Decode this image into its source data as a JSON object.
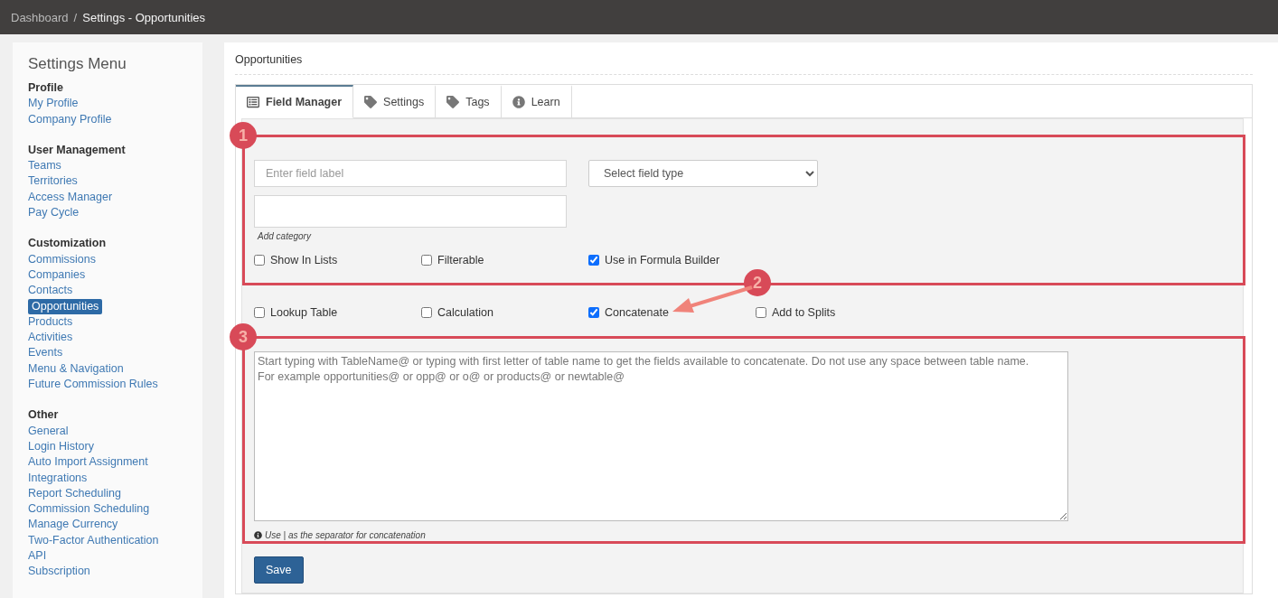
{
  "breadcrumb": {
    "items": [
      {
        "label": "Dashboard",
        "current": false
      },
      {
        "label": "Settings - Opportunities",
        "current": true
      }
    ],
    "separator": "/"
  },
  "sidebar": {
    "title": "Settings Menu",
    "groups": [
      {
        "heading": "Profile",
        "items": [
          {
            "label": "My Profile",
            "selected": false
          },
          {
            "label": "Company Profile",
            "selected": false
          }
        ]
      },
      {
        "heading": "User Management",
        "items": [
          {
            "label": "Teams",
            "selected": false
          },
          {
            "label": "Territories",
            "selected": false
          },
          {
            "label": "Access Manager",
            "selected": false
          },
          {
            "label": "Pay Cycle",
            "selected": false
          }
        ]
      },
      {
        "heading": "Customization",
        "items": [
          {
            "label": "Commissions",
            "selected": false
          },
          {
            "label": "Companies",
            "selected": false
          },
          {
            "label": "Contacts",
            "selected": false
          },
          {
            "label": "Opportunities",
            "selected": true
          },
          {
            "label": "Products",
            "selected": false
          },
          {
            "label": "Activities",
            "selected": false
          },
          {
            "label": "Events",
            "selected": false
          },
          {
            "label": "Menu & Navigation",
            "selected": false
          },
          {
            "label": "Future Commission Rules",
            "selected": false
          }
        ]
      },
      {
        "heading": "Other",
        "items": [
          {
            "label": "General",
            "selected": false
          },
          {
            "label": "Login History",
            "selected": false
          },
          {
            "label": "Auto Import Assignment",
            "selected": false
          },
          {
            "label": "Integrations",
            "selected": false
          },
          {
            "label": "Report Scheduling",
            "selected": false
          },
          {
            "label": "Commission Scheduling",
            "selected": false
          },
          {
            "label": "Manage Currency",
            "selected": false
          },
          {
            "label": "Two-Factor Authentication",
            "selected": false
          },
          {
            "label": "API",
            "selected": false
          },
          {
            "label": "Subscription",
            "selected": false
          }
        ]
      }
    ]
  },
  "page_title": "Opportunities",
  "tabs": [
    {
      "label": "Field Manager",
      "selected": true
    },
    {
      "label": "Settings",
      "selected": false
    },
    {
      "label": "Tags",
      "selected": false
    },
    {
      "label": "Learn",
      "selected": false
    }
  ],
  "form": {
    "field_label": {
      "placeholder": "Enter field label"
    },
    "field_type": {
      "value": "Select field type"
    },
    "category_caption": "Add category",
    "options_1": [
      {
        "label": "Show In Lists",
        "checked": false
      },
      {
        "label": "Filterable",
        "checked": false
      },
      {
        "label": "Use in Formula Builder",
        "checked": true
      }
    ],
    "options_2": [
      {
        "label": "Lookup Table",
        "checked": false
      },
      {
        "label": "Calculation",
        "checked": false
      },
      {
        "label": "Concatenate",
        "checked": true
      },
      {
        "label": "Add to Splits",
        "checked": false
      }
    ],
    "formula": {
      "placeholder": "Start typing with TableName@ or typing with first letter of table name to get the fields available to concatenate. Do not use any space between table name.\nFor example opportunities@ or opp@ or o@ or products@ or newtable@"
    },
    "hint": "Use | as the separator for concatenation",
    "save_button": "Save"
  },
  "annotations": [
    {
      "number": "1"
    },
    {
      "number": "2"
    },
    {
      "number": "3"
    }
  ]
}
